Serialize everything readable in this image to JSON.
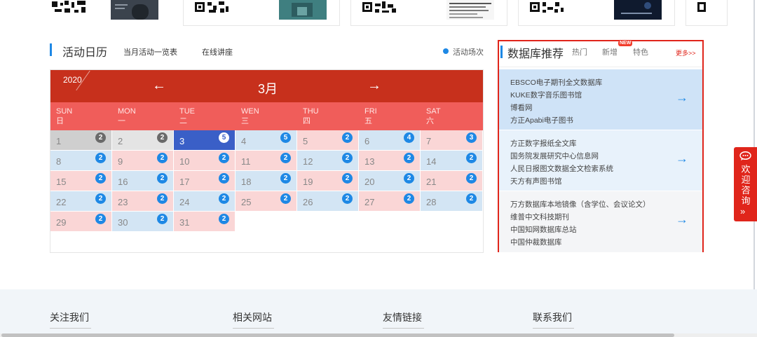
{
  "calendar_header": {
    "title": "活动日历",
    "tabs": [
      "当月活动一览表",
      "在线讲座"
    ],
    "legend": "活动场次"
  },
  "calendar": {
    "year": "2020",
    "month": "3月",
    "prev_icon": "←",
    "next_icon": "→",
    "weekdays": [
      {
        "en": "SUN",
        "cn": "日"
      },
      {
        "en": "MON",
        "cn": "一"
      },
      {
        "en": "TUE",
        "cn": "二"
      },
      {
        "en": "WEN",
        "cn": "三"
      },
      {
        "en": "THU",
        "cn": "四"
      },
      {
        "en": "FRI",
        "cn": "五"
      },
      {
        "en": "SAT",
        "cn": "六"
      }
    ],
    "days": [
      {
        "day": "1",
        "count": "2",
        "state": "past"
      },
      {
        "day": "2",
        "count": "2",
        "state": "past2"
      },
      {
        "day": "3",
        "count": "5",
        "state": "today"
      },
      {
        "day": "4",
        "count": "5",
        "state": "blue"
      },
      {
        "day": "5",
        "count": "2",
        "state": "pink"
      },
      {
        "day": "6",
        "count": "4",
        "state": "blue"
      },
      {
        "day": "7",
        "count": "3",
        "state": "pink"
      },
      {
        "day": "8",
        "count": "2",
        "state": "blue"
      },
      {
        "day": "9",
        "count": "2",
        "state": "pink"
      },
      {
        "day": "10",
        "count": "2",
        "state": "pink"
      },
      {
        "day": "11",
        "count": "2",
        "state": "pink"
      },
      {
        "day": "12",
        "count": "2",
        "state": "blue"
      },
      {
        "day": "13",
        "count": "2",
        "state": "pink"
      },
      {
        "day": "14",
        "count": "2",
        "state": "blue"
      },
      {
        "day": "15",
        "count": "2",
        "state": "pink"
      },
      {
        "day": "16",
        "count": "2",
        "state": "blue"
      },
      {
        "day": "17",
        "count": "2",
        "state": "pink"
      },
      {
        "day": "18",
        "count": "2",
        "state": "blue"
      },
      {
        "day": "19",
        "count": "2",
        "state": "pink"
      },
      {
        "day": "20",
        "count": "2",
        "state": "blue"
      },
      {
        "day": "21",
        "count": "2",
        "state": "pink"
      },
      {
        "day": "22",
        "count": "2",
        "state": "blue"
      },
      {
        "day": "23",
        "count": "2",
        "state": "pink"
      },
      {
        "day": "24",
        "count": "2",
        "state": "blue"
      },
      {
        "day": "25",
        "count": "2",
        "state": "pink"
      },
      {
        "day": "26",
        "count": "2",
        "state": "blue"
      },
      {
        "day": "27",
        "count": "2",
        "state": "pink"
      },
      {
        "day": "28",
        "count": "2",
        "state": "blue"
      },
      {
        "day": "29",
        "count": "2",
        "state": "pink"
      },
      {
        "day": "30",
        "count": "2",
        "state": "blue"
      },
      {
        "day": "31",
        "count": "2",
        "state": "pink"
      }
    ],
    "first_weekday": 0
  },
  "database_panel": {
    "title": "数据库推荐",
    "tabs": [
      "热门",
      "新增",
      "特色"
    ],
    "new_tag": "NEW",
    "more": "更多>>",
    "arrow_icon": "→",
    "groups": [
      [
        "EBSCO电子期刊全文数据库",
        "KUKE数字音乐图书馆",
        "博看网",
        "方正Apabi电子图书"
      ],
      [
        "方正数字报纸全文库",
        "国务院发展研究中心信息网",
        "人民日报图文数据全文检索系统",
        "天方有声图书馆"
      ],
      [
        "万方数据库本地镜像（含学位、会议论文）",
        "维普中文科技期刊",
        "中国知网数据库总站",
        "中国仲裁数据库"
      ]
    ]
  },
  "consult": {
    "text": [
      "欢",
      "迎",
      "咨",
      "询"
    ],
    "arrow": "»"
  },
  "footer": {
    "headings": [
      "关注我们",
      "相关网站",
      "友情链接",
      "联系我们"
    ]
  },
  "colors": {
    "accent_red": "#c7301c",
    "week_red": "#f05d5a",
    "badge_blue": "#1e88e5",
    "today_blue": "#3a5fc7"
  }
}
